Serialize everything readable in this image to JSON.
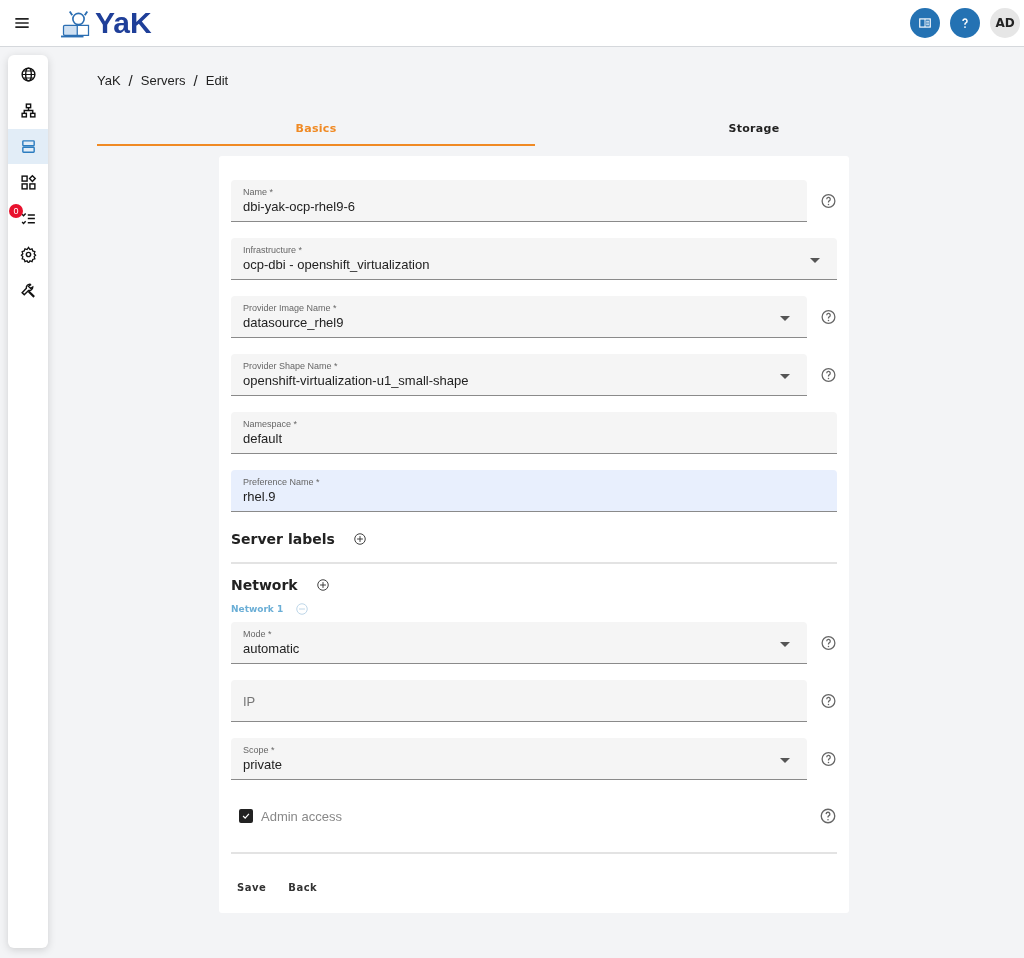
{
  "header": {
    "logo_text": "YaK",
    "avatar": "AD"
  },
  "sidebar": {
    "items": [
      {
        "selected": false
      },
      {
        "selected": false
      },
      {
        "selected": true
      },
      {
        "selected": false
      },
      {
        "selected": false,
        "badge": "0"
      },
      {
        "selected": false
      },
      {
        "selected": false
      }
    ]
  },
  "breadcrumb": [
    {
      "kind": "link",
      "text": "YaK"
    },
    {
      "kind": "separator",
      "text": "/"
    },
    {
      "kind": "link",
      "text": "Servers"
    },
    {
      "kind": "separator",
      "text": "/"
    },
    {
      "kind": "link",
      "text": "Edit"
    }
  ],
  "tabs": [
    {
      "label": "Basics",
      "selected": true
    },
    {
      "label": "Storage",
      "selected": false
    }
  ],
  "fields": [
    {
      "kind": "text",
      "label": "Name *",
      "value": "dbi-yak-ocp-rhel9-6",
      "help": true,
      "highlighted": false
    },
    {
      "kind": "select",
      "label": "Infrastructure *",
      "value": "ocp-dbi - openshift_virtualization",
      "help": false,
      "highlighted": false
    },
    {
      "kind": "select",
      "label": "Provider Image Name *",
      "value": "datasource_rhel9",
      "help": true,
      "highlighted": false
    },
    {
      "kind": "select",
      "label": "Provider Shape Name *",
      "value": "openshift-virtualization-u1_small-shape",
      "help": true,
      "highlighted": false
    },
    {
      "kind": "text",
      "label": "Namespace *",
      "value": "default",
      "help": false,
      "highlighted": false
    },
    {
      "kind": "text",
      "label": "Preference Name *",
      "value": "rhel.9",
      "help": false,
      "highlighted": true
    }
  ],
  "server_labels": {
    "title": "Server labels"
  },
  "network": {
    "title": "Network",
    "entries": [
      {
        "title": "Network 1",
        "fields": [
          {
            "kind": "select",
            "label": "Mode *",
            "value": "automatic",
            "help": true,
            "highlighted": false
          },
          {
            "kind": "text",
            "placeholder": "IP",
            "help": true,
            "highlighted": false
          },
          {
            "kind": "select",
            "label": "Scope *",
            "value": "private",
            "help": true,
            "highlighted": false
          }
        ],
        "admin_access": {
          "label": "Admin access",
          "checked": true,
          "help": true
        }
      }
    ]
  },
  "buttons": [
    "Save",
    "Back"
  ]
}
